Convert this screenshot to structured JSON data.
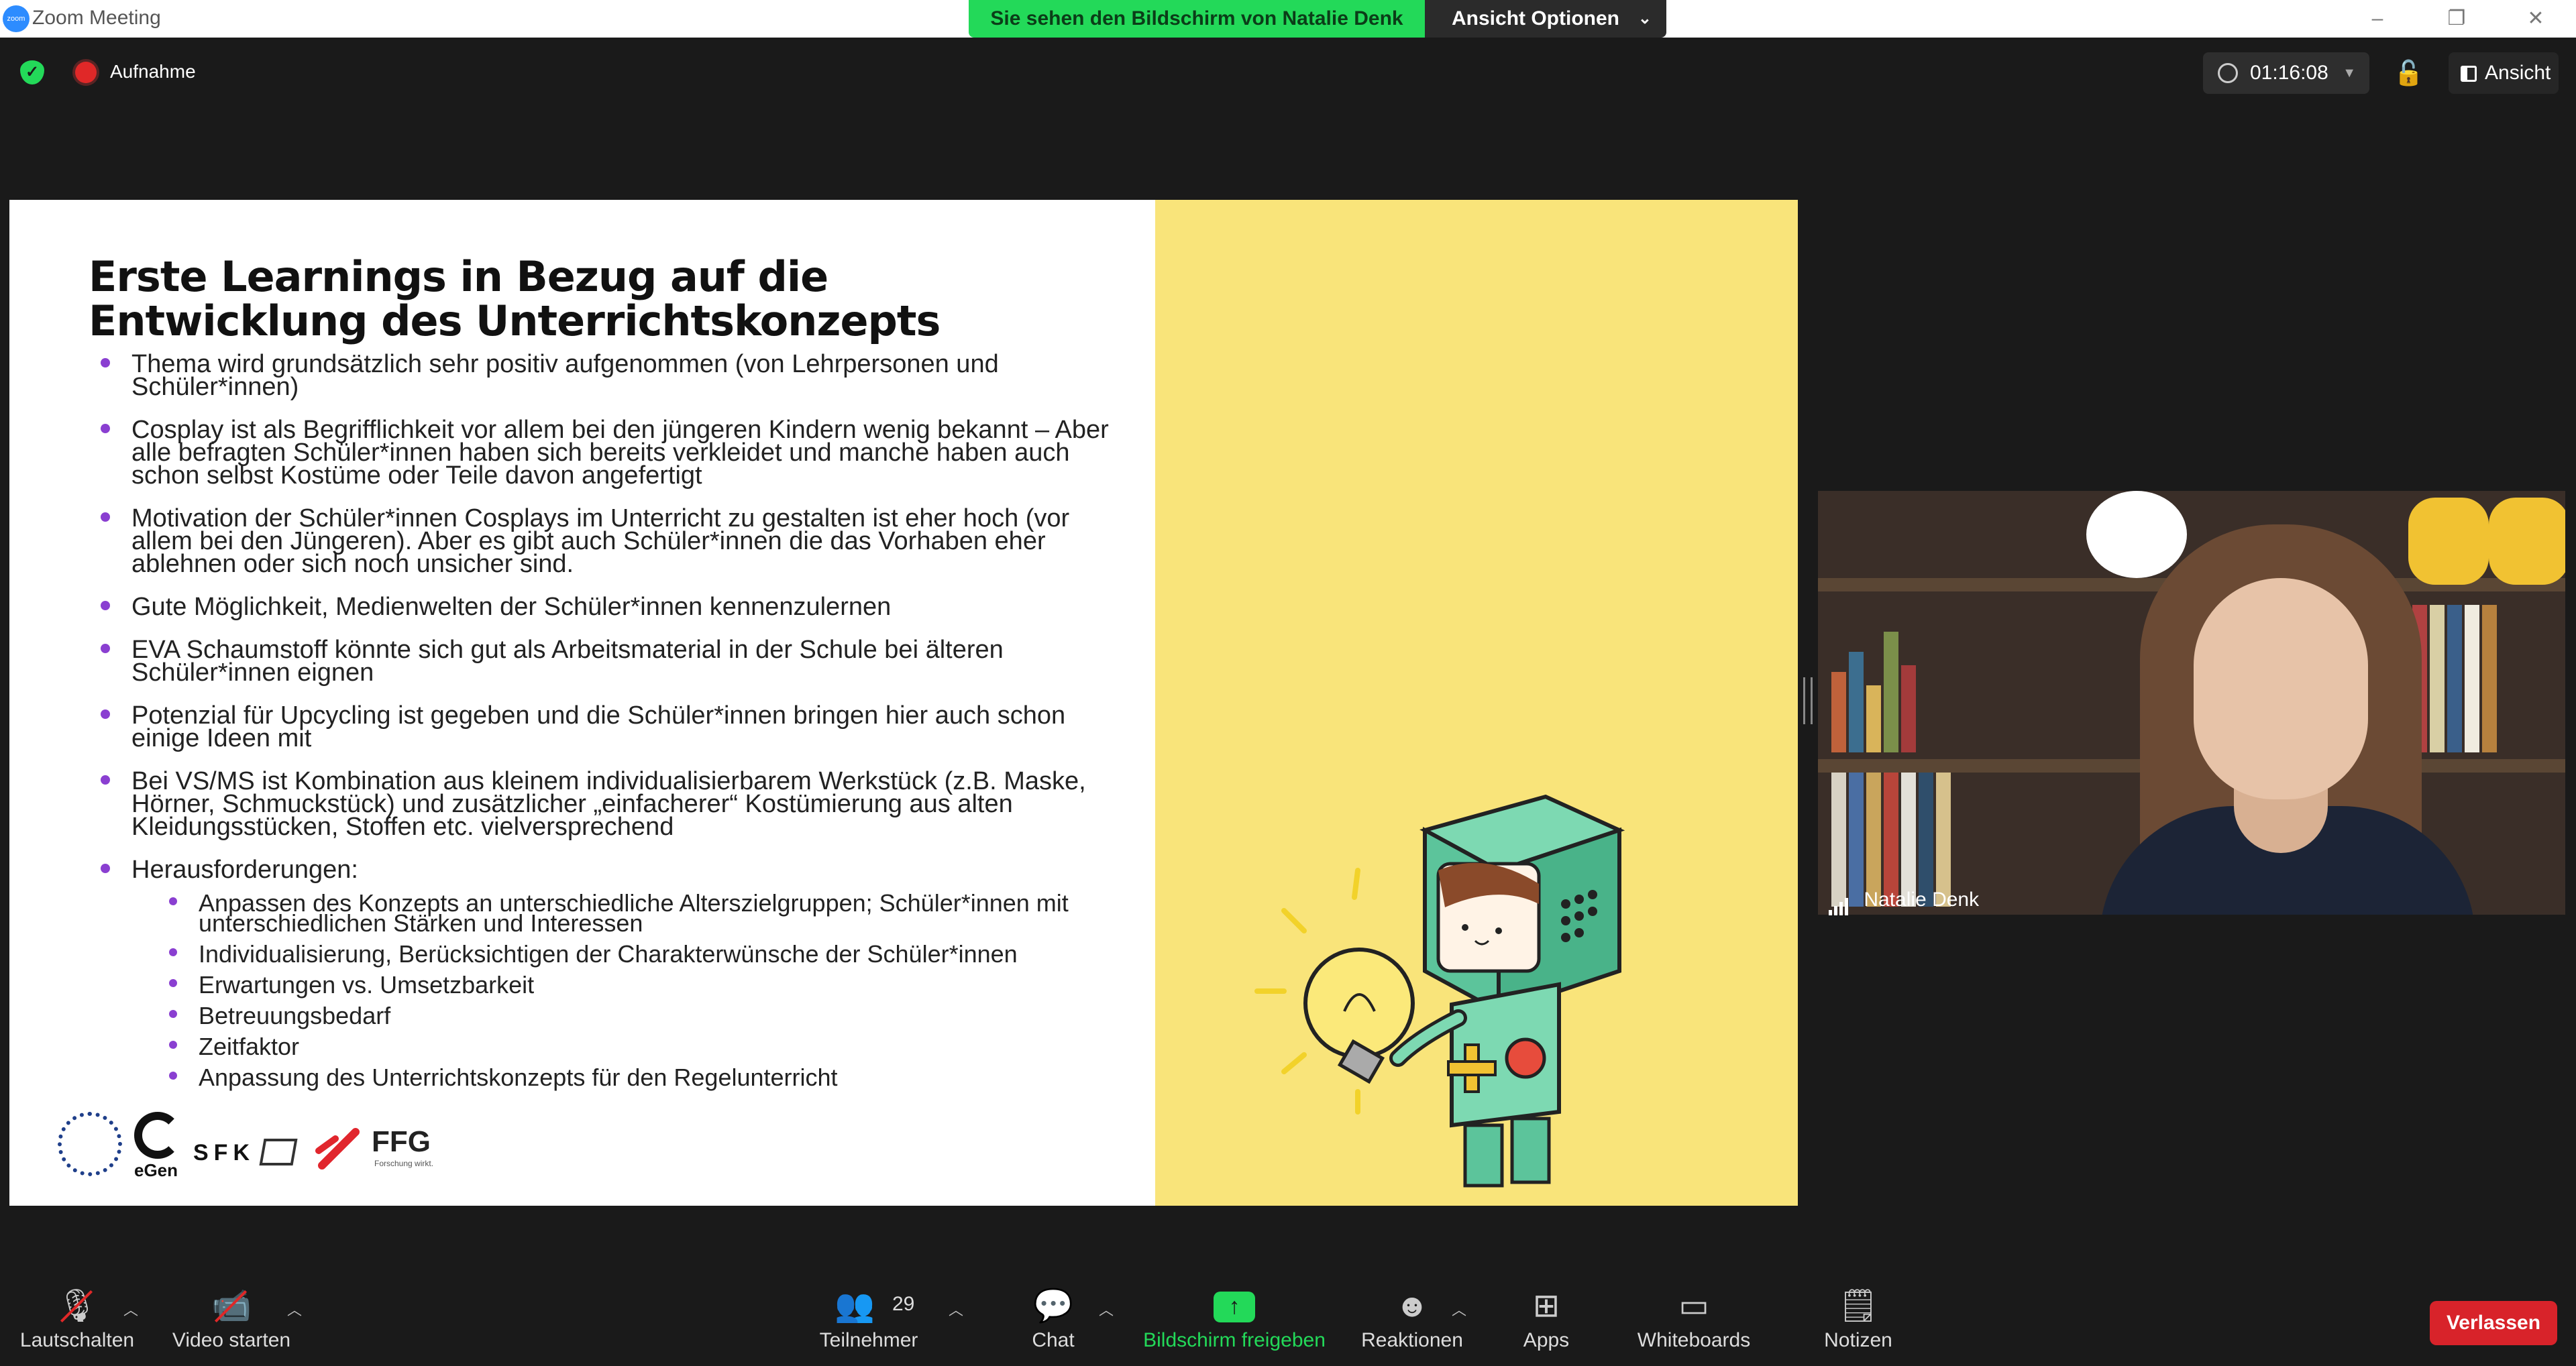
{
  "window": {
    "title": "Zoom Meeting",
    "app_icon_text": "zoom",
    "controls": [
      "–",
      "❐",
      "✕"
    ]
  },
  "share_banner": {
    "viewing": "Sie sehen den Bildschirm von Natalie Denk",
    "options": "Ansicht Optionen"
  },
  "top_bar": {
    "recording": "Aufnahme",
    "timer": "01:16:08",
    "view": "Ansicht"
  },
  "slide": {
    "title": "Erste Learnings in Bezug auf die Entwicklung des Unterrichtskonzepts",
    "bullets": [
      "Thema wird grundsätzlich sehr positiv aufgenommen (von Lehrpersonen und Schüler*innen)",
      "Cosplay ist als Begrifflichkeit vor allem bei den jüngeren Kindern wenig bekannt – Aber alle befragten Schüler*innen haben sich bereits verkleidet und manche haben auch schon selbst Kostüme oder Teile davon angefertigt",
      "Motivation der Schüler*innen Cosplays im Unterricht zu gestalten ist eher hoch (vor allem bei den Jüngeren). Aber es gibt auch Schüler*innen die das Vorhaben eher ablehnen oder sich noch unsicher sind.",
      "Gute Möglichkeit, Medienwelten der Schüler*innen kennenzulernen",
      "EVA Schaumstoff könnte sich gut als Arbeitsmaterial in der Schule bei älteren Schüler*innen eignen",
      "Potenzial für Upcycling ist gegeben und die Schüler*innen bringen hier auch schon einige Ideen mit",
      "Bei VS/MS ist Kombination aus kleinem individualisierbarem Werkstück (z.B. Maske, Hörner, Schmuckstück) und zusätzlicher „einfacherer“ Kostümierung aus alten Kleidungsstücken, Stoffen etc. vielversprechend",
      "Herausforderungen:"
    ],
    "sub_bullets": [
      "Anpassen des Konzepts an unterschiedliche Alterszielgruppen; Schüler*innen mit unterschiedlichen Stärken und Interessen",
      "Individualisierung, Berücksichtigen der Charakterwünsche der Schüler*innen",
      "Erwartungen vs. Umsetzbarkeit",
      "Betreuungsbedarf",
      "Zeitfaktor",
      "Anpassung des Unterrichtskonzepts für den Regelunterricht"
    ],
    "logos": {
      "egen": "eGen",
      "sfk": "SFK",
      "ffg": "FFG",
      "ffg_sub": "Forschung wirkt."
    }
  },
  "participant": {
    "name": "Natalie Denk"
  },
  "toolbar": {
    "mute": "Lautschalten",
    "video": "Video starten",
    "participants": "Teilnehmer",
    "participant_count": "29",
    "chat": "Chat",
    "share": "Bildschirm freigeben",
    "reactions": "Reaktionen",
    "apps": "Apps",
    "whiteboards": "Whiteboards",
    "notes": "Notizen",
    "leave": "Verlassen"
  },
  "colors": {
    "share_green": "#23d959",
    "bullet_purple": "#8a3fd1",
    "slide_yellow": "#f9e47a",
    "leave_red": "#d8232a"
  }
}
